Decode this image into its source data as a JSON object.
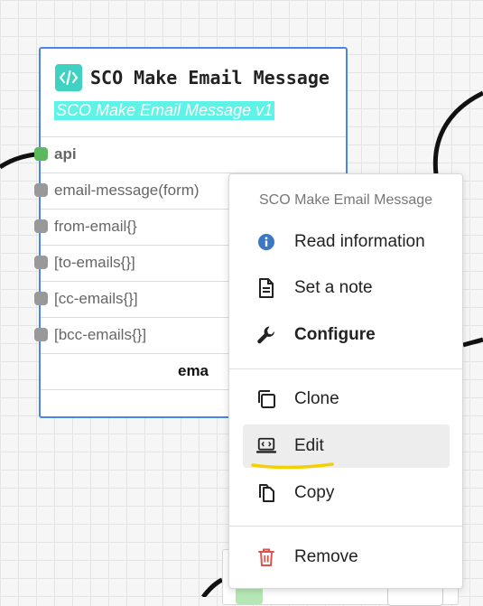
{
  "node": {
    "title": "SCO Make Email Message",
    "subtitle": "SCO Make Email Message v1",
    "ports": [
      {
        "label": "api"
      },
      {
        "label": "email-message(form)"
      },
      {
        "label": "from-email{}"
      },
      {
        "label": "[to-emails{}]"
      },
      {
        "label": "[cc-emails{}]"
      },
      {
        "label": "[bcc-emails{}]"
      }
    ],
    "output_label": "ema"
  },
  "menu": {
    "header": "SCO Make Email Message",
    "items": [
      {
        "label": "Read information",
        "icon": "info-icon"
      },
      {
        "label": "Set a note",
        "icon": "note-icon"
      },
      {
        "label": "Configure",
        "icon": "wrench-icon"
      },
      {
        "label": "Clone",
        "icon": "clone-icon"
      },
      {
        "label": "Edit",
        "icon": "edit-code-icon"
      },
      {
        "label": "Copy",
        "icon": "copy-icon"
      },
      {
        "label": "Remove",
        "icon": "trash-icon"
      }
    ]
  },
  "colors": {
    "node_border": "#4a86e8",
    "node_icon": "#3fd1c1",
    "subtitle_highlight": "#5ff2e6",
    "api_port": "#5cb85c",
    "info_icon": "#3b78c2",
    "remove_icon": "#d9534f",
    "annotation_underline": "#f5d000"
  }
}
